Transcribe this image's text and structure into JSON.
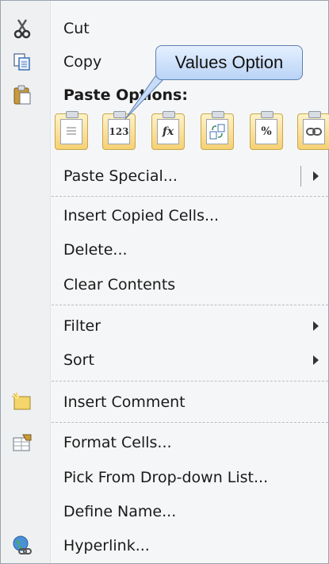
{
  "menu": {
    "cut": "Cut",
    "copy": "Copy",
    "paste_options": "Paste Options:",
    "paste_special": "Paste Special...",
    "insert_copied_cells": "Insert Copied Cells...",
    "delete": "Delete...",
    "clear_contents": "Clear Contents",
    "filter": "Filter",
    "sort": "Sort",
    "insert_comment": "Insert Comment",
    "format_cells": "Format Cells...",
    "pick_from_dropdown": "Pick From Drop-down List...",
    "define_name": "Define Name...",
    "hyperlink": "Hyperlink..."
  },
  "paste_buttons": {
    "values_text": "123",
    "formulas_text": "fx",
    "percent_text": "%"
  },
  "callout": {
    "text": "Values Option"
  },
  "icons": {
    "cut": "scissors-icon",
    "copy": "copy-icon",
    "paste": "clipboard-icon",
    "comment": "comment-icon",
    "format_cells": "format-cells-icon",
    "hyperlink": "hyperlink-globe-icon"
  },
  "colors": {
    "menu_bg": "#f5f6f7",
    "button_gold": "#f6d173",
    "callout_blue": "#b9d3f6"
  }
}
